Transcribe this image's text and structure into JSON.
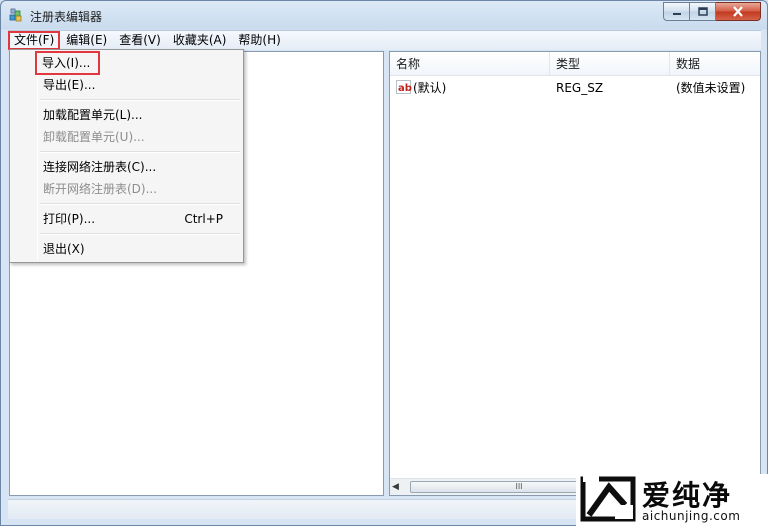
{
  "window": {
    "title": "注册表编辑器"
  },
  "menubar": [
    {
      "label": "文件(F)"
    },
    {
      "label": "编辑(E)"
    },
    {
      "label": "查看(V)"
    },
    {
      "label": "收藏夹(A)"
    },
    {
      "label": "帮助(H)"
    }
  ],
  "file_menu": {
    "items": [
      {
        "label": "导入(I)...",
        "enabled": true,
        "highlighted": true
      },
      {
        "label": "导出(E)...",
        "enabled": true
      },
      {
        "label": "加载配置单元(L)...",
        "enabled": true
      },
      {
        "label": "卸载配置单元(U)...",
        "enabled": false
      },
      {
        "label": "连接网络注册表(C)...",
        "enabled": true
      },
      {
        "label": "断开网络注册表(D)...",
        "enabled": false
      },
      {
        "label": "打印(P)...",
        "enabled": true,
        "shortcut": "Ctrl+P"
      },
      {
        "label": "退出(X)",
        "enabled": true
      }
    ]
  },
  "list": {
    "columns": [
      "名称",
      "类型",
      "数据"
    ],
    "rows": [
      {
        "icon": "string-value-icon",
        "name": "(默认)",
        "type": "REG_SZ",
        "data": "(数值未设置)"
      }
    ]
  },
  "scrollbar": {
    "grip": "III"
  },
  "watermark": {
    "title": "爱纯净",
    "url": "aichunjing.com"
  },
  "colors": {
    "highlight_border": "#e0383e",
    "titlebar": "#c9dbee"
  }
}
